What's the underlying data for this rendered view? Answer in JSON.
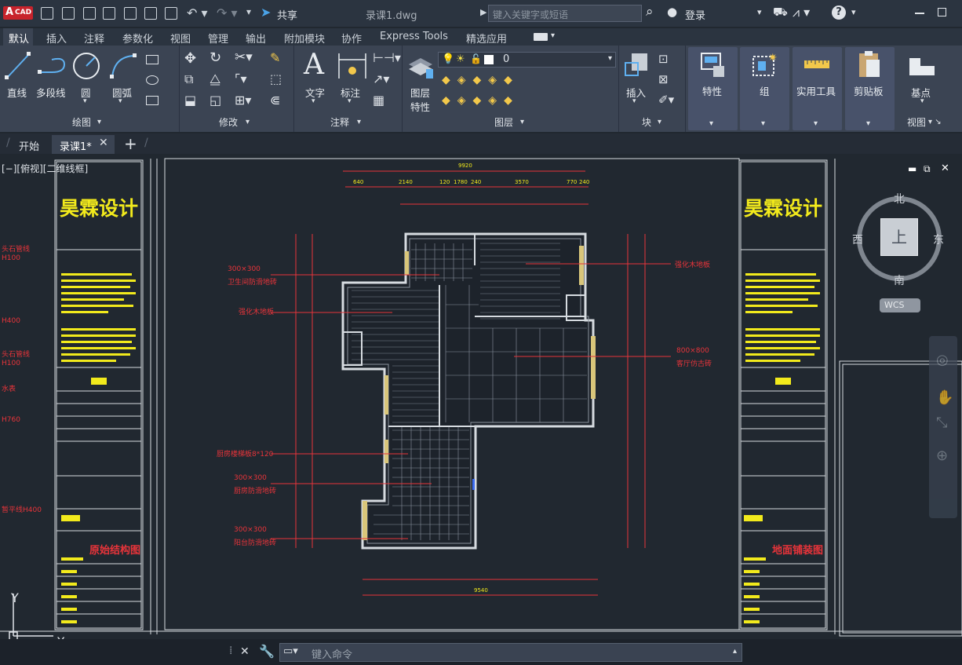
{
  "app": {
    "logo_badge": "A",
    "logo_text": "CAD"
  },
  "title": {
    "filename": "录课1.dwg",
    "share": "共享"
  },
  "search": {
    "placeholder": "键入关键字或短语"
  },
  "account": {
    "login": "登录"
  },
  "ribbon_tabs": [
    "默认",
    "插入",
    "注释",
    "参数化",
    "视图",
    "管理",
    "输出",
    "附加模块",
    "协作",
    "Express Tools",
    "精选应用"
  ],
  "ribbon": {
    "draw": {
      "line": "直线",
      "polyline": "多段线",
      "circle": "圆",
      "arc": "圆弧",
      "panel": "绘图"
    },
    "modify": {
      "panel": "修改"
    },
    "annotation": {
      "text": "文字",
      "dimension": "标注",
      "panel": "注释"
    },
    "layers": {
      "layer_props": "图层\n特性",
      "layer_props_l1": "图层",
      "layer_props_l2": "特性",
      "current_layer": "0",
      "panel": "图层"
    },
    "block": {
      "insert": "插入",
      "panel": "块"
    },
    "properties": "特性",
    "groups": "组",
    "utilities": "实用工具",
    "clipboard": "剪贴板",
    "basepoint": "基点",
    "view": {
      "panel": "视图"
    }
  },
  "doc_tabs": {
    "start": "开始",
    "active": "录课1*"
  },
  "viewport": {
    "label": "[−][俯视][二维线框]"
  },
  "viewcube": {
    "north": "北",
    "south": "南",
    "east": "东",
    "west": "西",
    "top": "上",
    "wcs": "WCS"
  },
  "drawing": {
    "brand": "昊霖设计",
    "left_sheet_title": "原始结构图",
    "right_sheet_title": "地面铺装图",
    "annotations_left": [
      "300×300",
      "卫生间防滑地砖",
      "强化木地板",
      "厨房楼梯板8*120",
      "300×300",
      "厨房防滑地砖",
      "300×300",
      "阳台防滑地砖"
    ],
    "annotations_right": [
      "强化木地板",
      "800×800",
      "客厅仿古砖"
    ],
    "side_notes": [
      "头石管线",
      "H100",
      "H400",
      "头石管线",
      "H100",
      "水表",
      "H760",
      "暂平线H400"
    ],
    "dims_top": [
      "9920",
      "640",
      "2140",
      "120",
      "1780",
      "240",
      "3570",
      "770",
      "240"
    ],
    "dims_bottom": [
      "9540"
    ]
  },
  "command": {
    "placeholder": "键入命令"
  },
  "ucs": {
    "y": "Y",
    "x": "X"
  }
}
